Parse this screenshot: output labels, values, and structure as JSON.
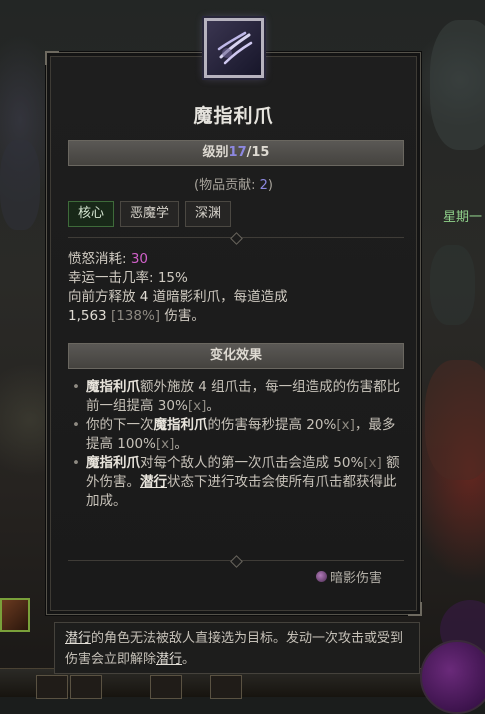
{
  "background": {
    "weekday_text": "星期一"
  },
  "tooltip": {
    "title": "魔指利爪",
    "rank": {
      "prefix": "级别",
      "current": "17",
      "sep": "/",
      "max": "15"
    },
    "contribution": {
      "prefix": "(物品贡献: ",
      "value": "2",
      "suffix": ")"
    },
    "tags": [
      "核心",
      "恶魔学",
      "深渊"
    ],
    "stats": {
      "fury_label": "愤怒消耗: ",
      "fury_value": "30",
      "lucky_hit": "幸运一击几率: 15%",
      "desc_line1_a": "向前方释放 ",
      "desc_line1_num": "4",
      "desc_line1_b": " 道暗影利爪，每道造成",
      "desc_line2_num": "1,563",
      "desc_line2_dim": " [138%]",
      "desc_line2_b": " 伤害。"
    },
    "modifier_header": "变化效果",
    "bullets": [
      {
        "kw": "魔指利爪",
        "t1": "额外施放 4 组爪击，每一组造成的伤害都比前一组提高 30%",
        "dim": "[x]",
        "t2": "。"
      },
      {
        "t0": "你的下一次",
        "kw": "魔指利爪",
        "t1": "的伤害每秒提高 20%",
        "dim": "[x]",
        "t2": "，最多提高 100%",
        "dim2": "[x]",
        "t3": "。"
      },
      {
        "kw": "魔指利爪",
        "t1": "对每个敌人的第一次爪击会造成 50%",
        "dim": "[x]",
        "t2": " 额外伤害。",
        "ul": "潜行",
        "t3": "状态下进行攻击会使所有爪击都获得此加成。"
      }
    ],
    "damage_type": "暗影伤害",
    "colors": {
      "rank_current": "#8d88e0",
      "fury_value": "#d060c8",
      "active_tag": "#3e6b3a"
    },
    "icon_name": "shadow-claw-icon"
  },
  "footnote": {
    "ul1": "潜行",
    "t1": "的角色无法被敌人直接选为目标。发动一次攻击或受到伤害会立即解除",
    "ul2": "潜行",
    "t2": "。"
  }
}
